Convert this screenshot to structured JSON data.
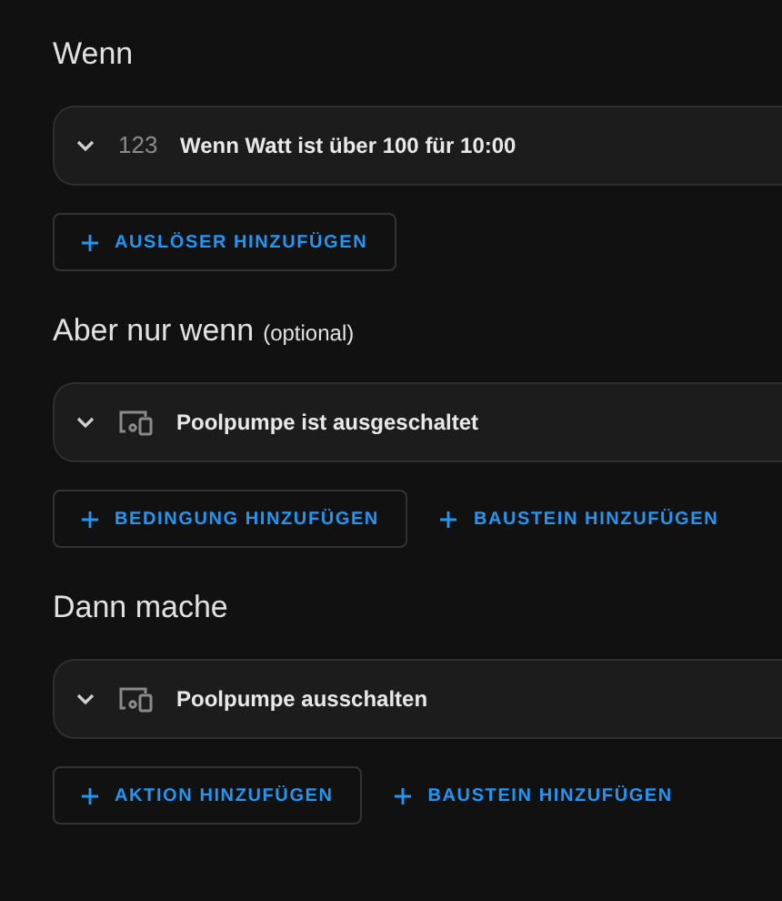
{
  "sections": [
    {
      "title": "Wenn",
      "card": {
        "expanded": false,
        "kind": "numeric",
        "icon_text": "123",
        "label": "Wenn Watt ist über 100 für 10:00"
      },
      "buttons": [
        {
          "label": "AUSLÖSER HINZUFÜGEN",
          "outlined": true
        }
      ]
    },
    {
      "title": "Aber nur wenn",
      "subtitle": "(optional)",
      "card": {
        "expanded": false,
        "kind": "device",
        "label": "Poolpumpe ist ausgeschaltet"
      },
      "buttons": [
        {
          "label": "BEDINGUNG HINZUFÜGEN",
          "outlined": true
        },
        {
          "label": "BAUSTEIN HINZUFÜGEN",
          "outlined": false
        }
      ]
    },
    {
      "title": "Dann mache",
      "card": {
        "expanded": false,
        "kind": "device",
        "label": "Poolpumpe ausschalten"
      },
      "buttons": [
        {
          "label": "AKTION HINZUFÜGEN",
          "outlined": true
        },
        {
          "label": "BAUSTEIN HINZUFÜGEN",
          "outlined": false
        }
      ]
    }
  ]
}
